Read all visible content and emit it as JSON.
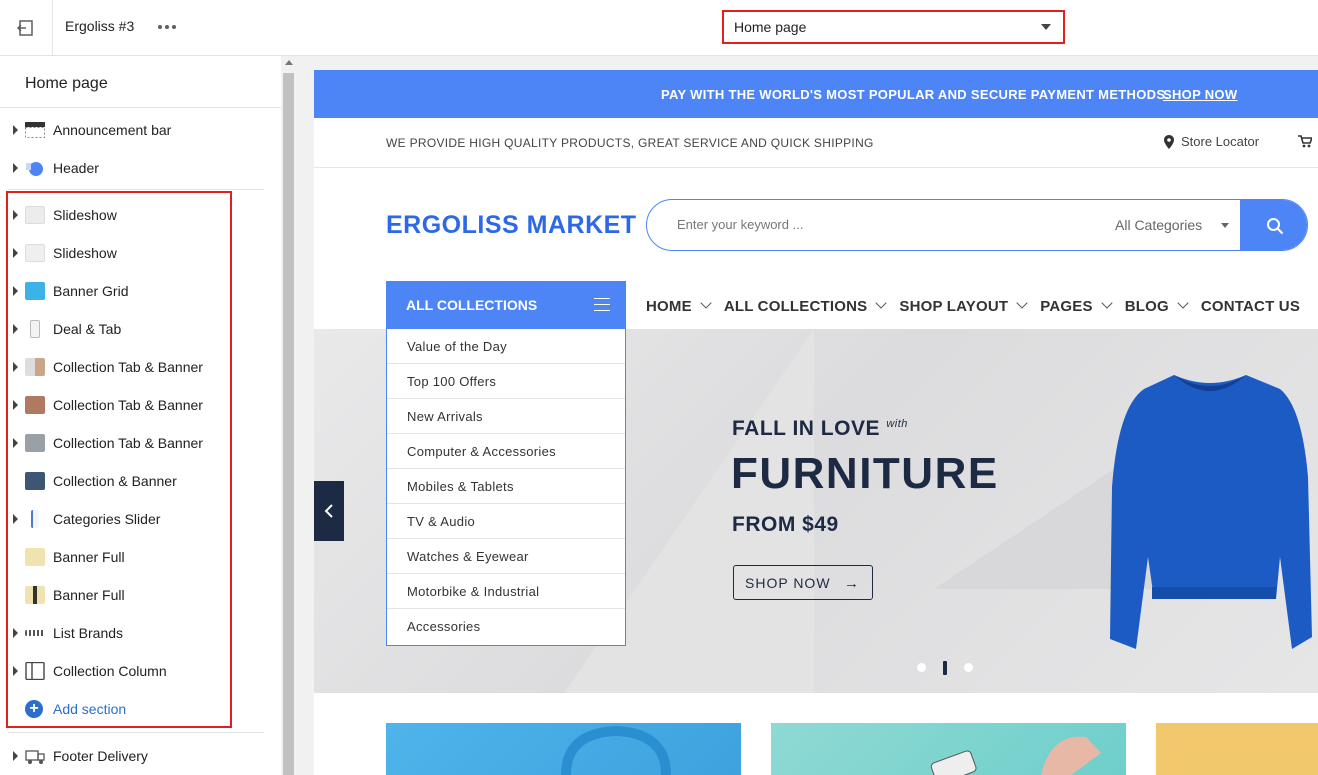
{
  "topbar": {
    "theme_name": "Ergoliss #3",
    "page_select": "Home page",
    "icons": {
      "exit": "exit-icon",
      "more": "more-dots-icon",
      "caret": "chevron-down-icon"
    }
  },
  "sidebar": {
    "title": "Home page",
    "header_sections": [
      {
        "label": "Announcement bar",
        "icon": "announcement-thumb"
      },
      {
        "label": "Header",
        "icon": "header-thumb"
      }
    ],
    "sections": [
      {
        "label": "Slideshow",
        "expandable": true
      },
      {
        "label": "Slideshow",
        "expandable": true
      },
      {
        "label": "Banner Grid",
        "expandable": true
      },
      {
        "label": "Deal & Tab",
        "expandable": true
      },
      {
        "label": "Collection Tab & Banner",
        "expandable": true
      },
      {
        "label": "Collection Tab & Banner",
        "expandable": true
      },
      {
        "label": "Collection Tab & Banner",
        "expandable": true
      },
      {
        "label": "Collection & Banner",
        "expandable": false
      },
      {
        "label": "Categories Slider",
        "expandable": true
      },
      {
        "label": "Banner Full",
        "expandable": false
      },
      {
        "label": "Banner Full",
        "expandable": false
      },
      {
        "label": "List Brands",
        "expandable": true
      },
      {
        "label": "Collection Column",
        "expandable": true
      }
    ],
    "add_section": "Add section",
    "footer_sections": [
      {
        "label": "Footer Delivery",
        "icon": "footer-thumb"
      }
    ]
  },
  "preview": {
    "announcement": {
      "text": "PAY WITH THE WORLD'S MOST POPULAR AND SECURE PAYMENT METHODS.",
      "link": "SHOP NOW"
    },
    "topstrip": {
      "text": "WE PROVIDE HIGH QUALITY PRODUCTS, GREAT SERVICE AND QUICK SHIPPING",
      "store_locator": "Store Locator"
    },
    "logo": "ERGOLISS MARKET",
    "search": {
      "placeholder": "Enter your keyword ...",
      "category": "All Categories"
    },
    "all_collections": "ALL COLLECTIONS",
    "nav": [
      "HOME",
      "ALL COLLECTIONS",
      "SHOP LAYOUT",
      "PAGES",
      "BLOG",
      "CONTACT US"
    ],
    "menu": [
      "Value of the Day",
      "Top 100 Offers",
      "New Arrivals",
      "Computer & Accessories",
      "Mobiles & Tablets",
      "TV & Audio",
      "Watches & Eyewear",
      "Motorbike & Industrial",
      "Accessories"
    ],
    "hero": {
      "line1": "FALL IN LOVE",
      "line1_small": "with",
      "headline": "FURNITURE",
      "price": "FROM $49",
      "cta": "SHOP NOW",
      "slide_active": 2,
      "slide_count": 3
    },
    "colors": {
      "accent": "#4d85f7",
      "logo": "#2c69e8",
      "dark": "#1d2a44",
      "highlight": "#e0201f"
    }
  }
}
